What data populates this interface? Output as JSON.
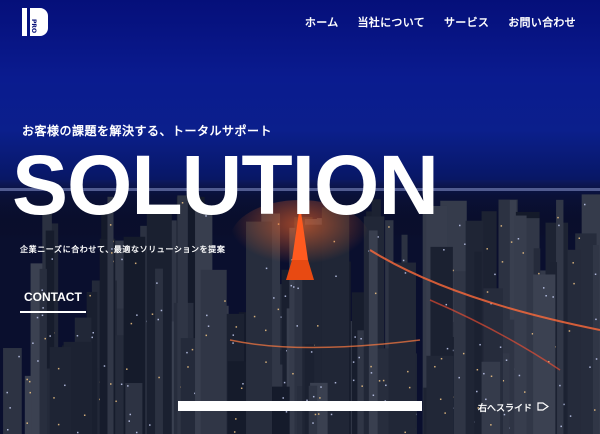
{
  "nav": {
    "items": [
      {
        "label": "ホーム"
      },
      {
        "label": "当社について"
      },
      {
        "label": "サービス"
      },
      {
        "label": "お問い合わせ"
      }
    ]
  },
  "logo": {
    "icon": "company-logo-icon",
    "text": "PRO"
  },
  "hero": {
    "tagline": "お客様の課題を解決する、トータルサポート",
    "headline": "SOLUTION",
    "subtext": "企業ニーズに合わせて、最適なソリューションを提案",
    "contact_label": "CONTACT",
    "next_slide_label": "右へスライド",
    "next_slide_icon": "arrow-right-icon",
    "slide_progress": 1.0
  },
  "colors": {
    "sky_top": "#050f7a",
    "sky_mid": "#0b1f8c",
    "night": "#06081a",
    "text": "#ffffff"
  }
}
